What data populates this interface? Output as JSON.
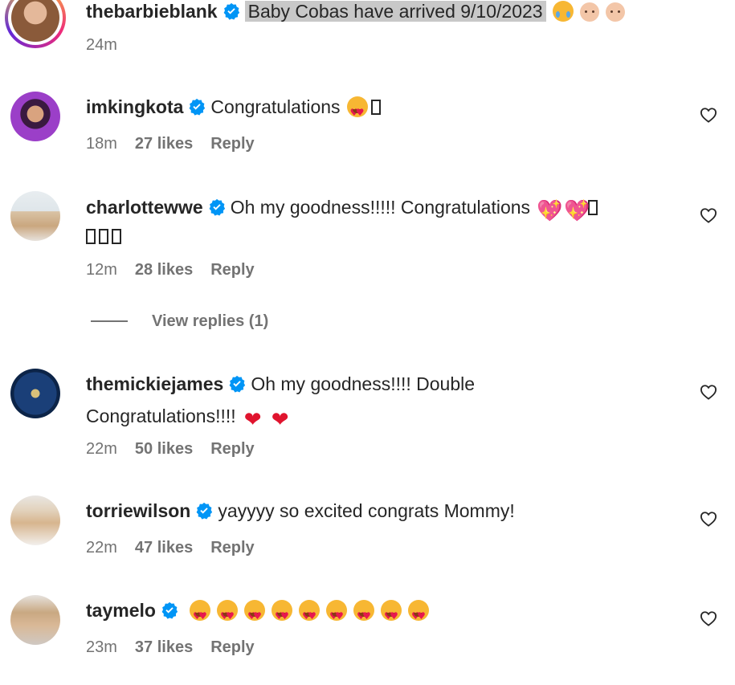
{
  "caption": {
    "username": "thebarbieblank",
    "text": "Baby Cobas have arrived 9/10/2023",
    "time": "24m"
  },
  "comments": [
    {
      "username": "imkingkota",
      "text": "Congratulations",
      "time": "18m",
      "likes": "27 likes",
      "reply": "Reply"
    },
    {
      "username": "charlottewwe",
      "text": "Oh my goodness!!!!! Congratulations",
      "time": "12m",
      "likes": "28 likes",
      "reply": "Reply",
      "view_replies": "View replies (1)"
    },
    {
      "username": "themickiejames",
      "text": "Oh my goodness!!!! Double",
      "text2": "Congratulations!!!!",
      "time": "22m",
      "likes": "50 likes",
      "reply": "Reply"
    },
    {
      "username": "torriewilson",
      "text": "yayyyy so excited congrats Mommy!",
      "time": "22m",
      "likes": "47 likes",
      "reply": "Reply"
    },
    {
      "username": "taymelo",
      "text": "",
      "time": "23m",
      "likes": "37 likes",
      "reply": "Reply"
    }
  ],
  "icons": {
    "verified": "verified-badge-icon",
    "like": "heart-outline-icon"
  },
  "colors": {
    "verified": "#0095f6",
    "meta": "#737373",
    "text": "#262626",
    "highlight": "#c8c8c8"
  }
}
